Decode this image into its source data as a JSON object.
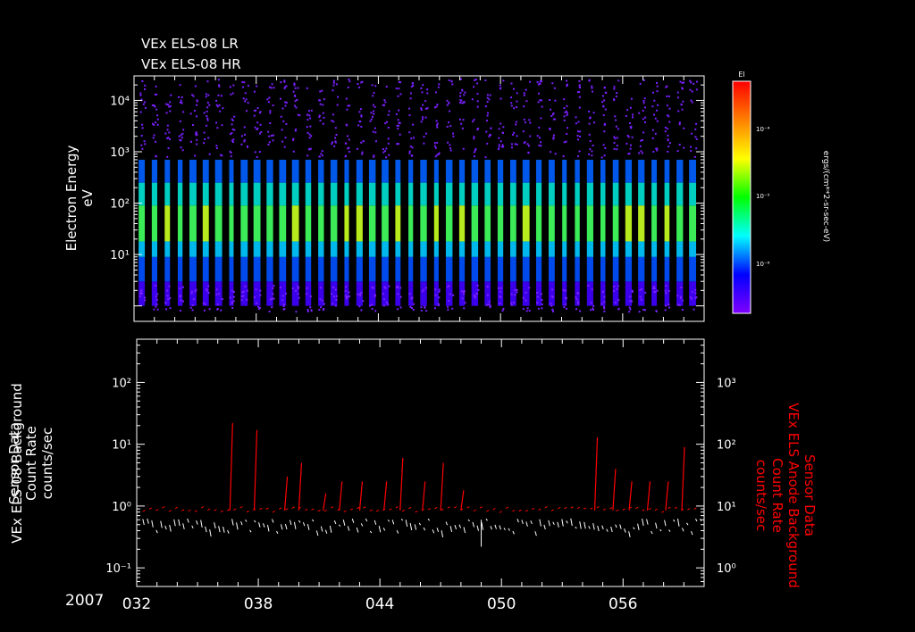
{
  "titles": [
    "VEx ELS-08 LR",
    "VEx ELS-08 HR"
  ],
  "year_label": "2007",
  "x_tick_labels": [
    "032",
    "038",
    "044",
    "050",
    "056"
  ],
  "colorbar": {
    "title": "El",
    "tick_labels": [
      "10⁻⁴",
      "10⁻⁵",
      "10⁻⁶"
    ],
    "unit_label": "ergs/(cm**2-sr-sec-eV)",
    "colors": [
      "#ff0000",
      "#ff8000",
      "#ffff00",
      "#00ff00",
      "#00ffff",
      "#0000ff",
      "#8000ff"
    ]
  },
  "colors": {
    "background": "#000000",
    "axes": "#ffffff",
    "text": "#ffffff",
    "anode_series": "#ff0000",
    "background_series": "#ffffff"
  },
  "chart_data": [
    {
      "type": "heatmap",
      "title": "VEx ELS-08 LR / VEx ELS-08 HR",
      "ylabel_lines": [
        "Electron Energy",
        "eV"
      ],
      "yscale": "log",
      "ylim": [
        0.5,
        30000
      ],
      "ytick_labels": [
        "10¹",
        "10²",
        "10³",
        "10⁴"
      ],
      "xlim": [
        32,
        60
      ],
      "xlabel": "2007",
      "xtick_labels": [
        "032",
        "038",
        "044",
        "050",
        "056"
      ],
      "pass_count": 44,
      "peak_energy_ev": 40,
      "colorbar_label": "ergs/(cm**2-sr-sec-eV)",
      "zscale": "log",
      "zlim": [
        2e-07,
        0.0005
      ]
    },
    {
      "type": "line",
      "left_axis": {
        "label_lines": [
          "Sensor Data",
          "VEx ELS-08 Background",
          "Count Rate",
          "counts/sec"
        ],
        "scale": "log",
        "ylim": [
          0.05,
          500
        ],
        "tick_labels": [
          "10⁻¹",
          "10⁰",
          "10¹",
          "10²"
        ]
      },
      "right_axis": {
        "label_lines": [
          "Sensor Data",
          "VEx ELS Anode Background",
          "Count Rate",
          "counts/sec"
        ],
        "scale": "log",
        "ylim": [
          0.5,
          5000
        ],
        "tick_labels": [
          "10⁰",
          "10¹",
          "10²",
          "10³"
        ]
      },
      "xlim": [
        32,
        60
      ],
      "xtick_labels": [
        "032",
        "038",
        "044",
        "050",
        "056"
      ],
      "series": [
        {
          "axis": "right",
          "x": [
            36.6,
            37.8,
            39.3,
            40.0,
            41.2,
            42.0,
            43.0,
            44.2,
            45.0,
            46.1,
            47.0,
            48.0,
            54.6,
            55.5,
            56.3,
            57.2,
            58.1,
            58.9
          ],
          "peak": [
            220,
            170,
            30,
            50,
            16,
            25,
            25,
            25,
            60,
            25,
            50,
            18,
            130,
            40,
            25,
            25,
            25,
            90
          ],
          "base": 8.5
        },
        {
          "axis": "left",
          "x": [
            32,
            60
          ],
          "base": 0.55
        }
      ]
    }
  ]
}
